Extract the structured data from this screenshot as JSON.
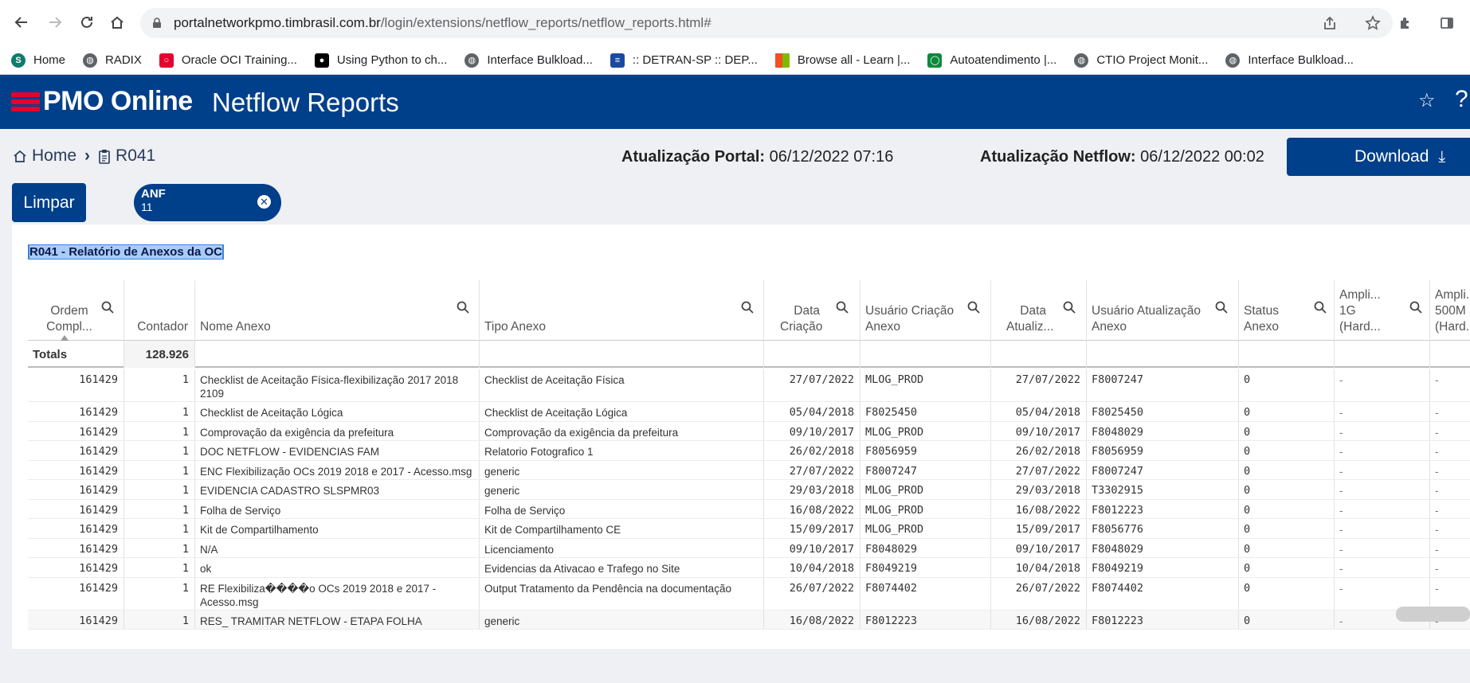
{
  "browser": {
    "url_domain": "portalnetworkpmo.timbrasil.com.br",
    "url_path": "/login/extensions/netflow_reports/netflow_reports.html#",
    "bookmarks": [
      {
        "label": "Home",
        "icon": "sharepoint-icon",
        "color": "#0f7b6c"
      },
      {
        "label": "RADIX",
        "icon": "globe-icon",
        "color": "#5f6368"
      },
      {
        "label": "Oracle OCI Training...",
        "icon": "oracle-icon",
        "color": "#e4032e"
      },
      {
        "label": "Using Python to ch...",
        "icon": "medium-icon",
        "color": "#000000"
      },
      {
        "label": "Interface Bulkload...",
        "icon": "globe-icon",
        "color": "#5f6368"
      },
      {
        "label": ":: DETRAN-SP :: DEP...",
        "icon": "detran-icon",
        "color": "#1a4aa0"
      },
      {
        "label": "Browse all - Learn |...",
        "icon": "microsoft-icon",
        "color": "#f25022"
      },
      {
        "label": "Autoatendimento |...",
        "icon": "autoatendimento-icon",
        "color": "#0a8a3a"
      },
      {
        "label": "CTIO Project Monit...",
        "icon": "globe-icon",
        "color": "#5f6368"
      },
      {
        "label": "Interface Bulkload...",
        "icon": "globe-icon",
        "color": "#5f6368"
      }
    ]
  },
  "app": {
    "brand": "PMO Online",
    "title": "Netflow Reports",
    "accent": "#003f8a",
    "logo_color": "#e4032e"
  },
  "breadcrumb": {
    "home": "Home",
    "current": "R041"
  },
  "updates": {
    "portal_label": "Atualização Portal:",
    "portal_value": "06/12/2022 07:16",
    "netflow_label": "Atualização Netflow:",
    "netflow_value": "06/12/2022 00:02"
  },
  "actions": {
    "download": "Download",
    "clear": "Limpar"
  },
  "filter_chip": {
    "key": "ANF",
    "value": "11"
  },
  "report": {
    "title": "R041 - Relatório de Anexos da OC",
    "columns": [
      "Ordem Compl...",
      "Contador",
      "Nome Anexo",
      "Tipo Anexo",
      "Data Criação",
      "Usuário Criação Anexo",
      "Data Atualiz...",
      "Usuário Atualização Anexo",
      "Status Anexo",
      "Ampli... 1G (Hard...",
      "Ampli... 500M (Hard..."
    ],
    "totals_label": "Totals",
    "totals_contador": "128.926",
    "rows": [
      {
        "ordem": "161429",
        "contador": "1",
        "nome": "Checklist de Aceitação Física-flexibilização 2017 2018 2109",
        "tipo": "Checklist de Aceitação Física",
        "data_criacao": "27/07/2022",
        "usuario_criacao": "MLOG_PROD",
        "data_atualiz": "27/07/2022",
        "usuario_atualiz": "F8007247",
        "status": "0",
        "ampli1g": "-",
        "ampli500m": "-"
      },
      {
        "ordem": "161429",
        "contador": "1",
        "nome": "Checklist de Aceitação Lógica",
        "tipo": "Checklist de Aceitação Lógica",
        "data_criacao": "05/04/2018",
        "usuario_criacao": "F8025450",
        "data_atualiz": "05/04/2018",
        "usuario_atualiz": "F8025450",
        "status": "0",
        "ampli1g": "-",
        "ampli500m": "-"
      },
      {
        "ordem": "161429",
        "contador": "1",
        "nome": "Comprovação da exigência da prefeitura",
        "tipo": "Comprovação da exigência da prefeitura",
        "data_criacao": "09/10/2017",
        "usuario_criacao": "MLOG_PROD",
        "data_atualiz": "09/10/2017",
        "usuario_atualiz": "F8048029",
        "status": "0",
        "ampli1g": "-",
        "ampli500m": "-"
      },
      {
        "ordem": "161429",
        "contador": "1",
        "nome": "DOC NETFLOW - EVIDENCIAS FAM",
        "tipo": "Relatorio Fotografico 1",
        "data_criacao": "26/02/2018",
        "usuario_criacao": "F8056959",
        "data_atualiz": "26/02/2018",
        "usuario_atualiz": "F8056959",
        "status": "0",
        "ampli1g": "-",
        "ampli500m": "-"
      },
      {
        "ordem": "161429",
        "contador": "1",
        "nome": "ENC Flexibilização OCs 2019 2018 e 2017 - Acesso.msg",
        "tipo": "generic",
        "data_criacao": "27/07/2022",
        "usuario_criacao": "F8007247",
        "data_atualiz": "27/07/2022",
        "usuario_atualiz": "F8007247",
        "status": "0",
        "ampli1g": "-",
        "ampli500m": "-"
      },
      {
        "ordem": "161429",
        "contador": "1",
        "nome": "EVIDENCIA CADASTRO SLSPMR03",
        "tipo": "generic",
        "data_criacao": "29/03/2018",
        "usuario_criacao": "MLOG_PROD",
        "data_atualiz": "29/03/2018",
        "usuario_atualiz": "T3302915",
        "status": "0",
        "ampli1g": "-",
        "ampli500m": "-"
      },
      {
        "ordem": "161429",
        "contador": "1",
        "nome": "Folha de Serviço",
        "tipo": "Folha de Serviço",
        "data_criacao": "16/08/2022",
        "usuario_criacao": "MLOG_PROD",
        "data_atualiz": "16/08/2022",
        "usuario_atualiz": "F8012223",
        "status": "0",
        "ampli1g": "-",
        "ampli500m": "-"
      },
      {
        "ordem": "161429",
        "contador": "1",
        "nome": "Kit de Compartilhamento",
        "tipo": "Kit de Compartilhamento CE",
        "data_criacao": "15/09/2017",
        "usuario_criacao": "MLOG_PROD",
        "data_atualiz": "15/09/2017",
        "usuario_atualiz": "F8056776",
        "status": "0",
        "ampli1g": "-",
        "ampli500m": "-"
      },
      {
        "ordem": "161429",
        "contador": "1",
        "nome": "N/A",
        "tipo": "Licenciamento",
        "data_criacao": "09/10/2017",
        "usuario_criacao": "F8048029",
        "data_atualiz": "09/10/2017",
        "usuario_atualiz": "F8048029",
        "status": "0",
        "ampli1g": "-",
        "ampli500m": "-"
      },
      {
        "ordem": "161429",
        "contador": "1",
        "nome": "ok",
        "tipo": "Evidencias da Ativacao e Trafego no Site",
        "data_criacao": "10/04/2018",
        "usuario_criacao": "F8049219",
        "data_atualiz": "10/04/2018",
        "usuario_atualiz": "F8049219",
        "status": "0",
        "ampli1g": "-",
        "ampli500m": "-"
      },
      {
        "ordem": "161429",
        "contador": "1",
        "nome": "RE Flexibiliza����o OCs 2019 2018 e 2017 - Acesso.msg",
        "tipo": "Output Tratamento da Pendência na documentação",
        "data_criacao": "26/07/2022",
        "usuario_criacao": "F8074402",
        "data_atualiz": "26/07/2022",
        "usuario_atualiz": "F8074402",
        "status": "0",
        "ampli1g": "-",
        "ampli500m": "-"
      },
      {
        "ordem": "161429",
        "contador": "1",
        "nome": "RES_ TRAMITAR NETFLOW - ETAPA FOLHA",
        "tipo": "generic",
        "data_criacao": "16/08/2022",
        "usuario_criacao": "F8012223",
        "data_atualiz": "16/08/2022",
        "usuario_atualiz": "F8012223",
        "status": "0",
        "ampli1g": "-",
        "ampli500m": "-"
      }
    ]
  }
}
